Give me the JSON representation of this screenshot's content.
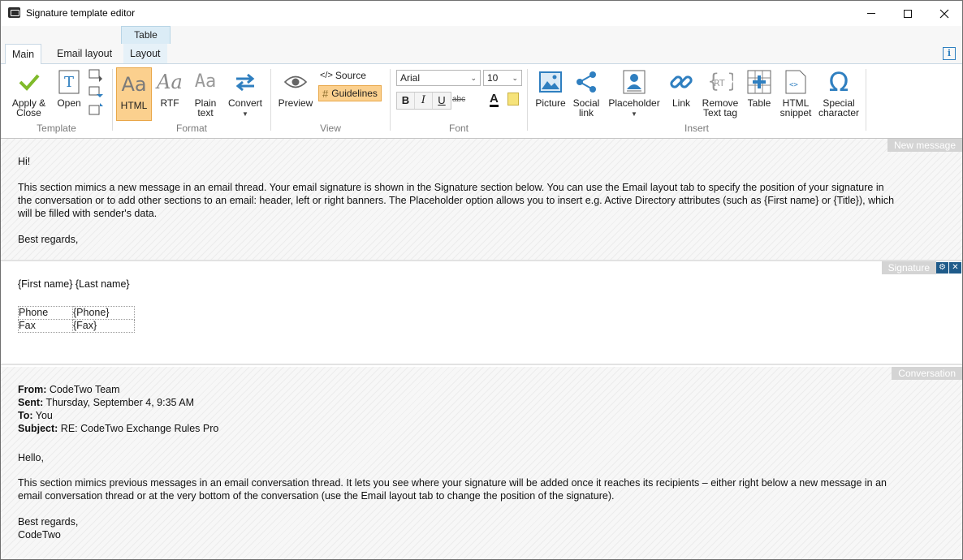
{
  "window": {
    "title": "Signature template editor"
  },
  "ribbon": {
    "context_tab_header": "Table",
    "tabs": [
      {
        "label": "Main",
        "active": true
      },
      {
        "label": "Email layout",
        "active": false
      },
      {
        "label": "Layout",
        "active": false
      }
    ],
    "groups": {
      "template": {
        "label": "Template",
        "apply_close": "Apply &\nClose",
        "open": "Open"
      },
      "format": {
        "label": "Format",
        "html": "HTML",
        "rtf": "RTF",
        "plain_text": "Plain\ntext",
        "convert": "Convert",
        "sample_glyph": "Aa"
      },
      "view": {
        "label": "View",
        "preview": "Preview",
        "source": "Source",
        "guidelines": "Guidelines"
      },
      "font": {
        "label": "Font",
        "font_name": "Arial",
        "font_size": "10",
        "bold": "B",
        "italic": "I",
        "underline": "U",
        "strike": "abc",
        "font_color": "A"
      },
      "insert": {
        "label": "Insert",
        "picture": "Picture",
        "social_link": "Social\nlink",
        "placeholder": "Placeholder",
        "link": "Link",
        "remove_text_tag": "Remove\nText tag",
        "table": "Table",
        "html_snippet": "HTML\nsnippet",
        "special_character": "Special\ncharacter"
      }
    },
    "colors": {
      "selected_bg": "#fbd08e",
      "selected_border": "#e9a748",
      "accent_blue": "#2f7fc0"
    }
  },
  "sections": {
    "new_message": {
      "label": "New message",
      "greeting": "Hi!",
      "body_line1": "This section mimics a new message in an email thread. Your email signature is shown in the Signature section below. You can use the Email layout tab to specify the position of your signature in",
      "body_line2": "the conversation or to add other sections to an email: header, left or right banners. The Placeholder option allows you to insert e.g. Active Directory attributes (such as {First name} or {Title}), which",
      "body_line3": "will be filled with sender's data.",
      "closing": "Best regards,"
    },
    "signature": {
      "label": "Signature",
      "name_line": "{First name} {Last name}",
      "rows": [
        {
          "key": "Phone",
          "value": "{Phone}"
        },
        {
          "key": "Fax",
          "value": "{Fax}"
        }
      ]
    },
    "conversation": {
      "label": "Conversation",
      "from_label": "From:",
      "from_value": "CodeTwo Team",
      "sent_label": "Sent:",
      "sent_value": "Thursday, September 4, 9:35 AM",
      "to_label": "To:",
      "to_value": "You",
      "subject_label": "Subject:",
      "subject_value": "RE: CodeTwo Exchange Rules Pro",
      "greeting": "Hello,",
      "body_line1": "This section mimics previous messages in an email conversation thread. It lets you see where your signature will be added once it reaches its recipients – either right below a new message in an",
      "body_line2": "email conversation thread or at the very bottom of the conversation (use the Email layout tab to change the position of the signature).",
      "closing1": "Best regards,",
      "closing2": "CodeTwo"
    }
  }
}
